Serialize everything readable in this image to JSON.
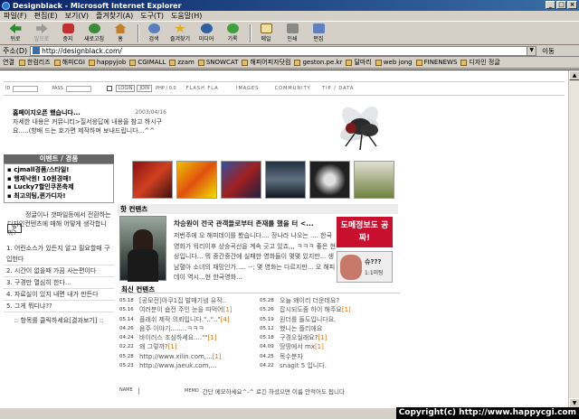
{
  "window": {
    "tab_title": "Designblack",
    "app_title": "Microsoft Internet Explorer"
  },
  "menu": [
    "파일(F)",
    "편집(E)",
    "보기(V)",
    "즐겨찾기(A)",
    "도구(T)",
    "도움말(H)"
  ],
  "toolbar": {
    "back": "뒤로",
    "forward": "앞으로",
    "stop": "중지",
    "refresh": "새로고침",
    "home": "홈",
    "search": "검색",
    "favorites": "즐겨찾기",
    "media": "미디어",
    "history": "기록",
    "mail": "메일",
    "print": "인쇄",
    "edit": "편집"
  },
  "address": {
    "label": "주소(D)",
    "url": "http://designblack.com/",
    "go": "이동"
  },
  "links": {
    "label": "연결",
    "items": [
      "한컴리즈",
      "해피CGI",
      "happyjob",
      "CGIMALL",
      "zzam",
      "SNOWCAT",
      "해피어피자닷컴",
      "geston.pe.kr",
      "달마리",
      "web jong",
      "FINENEWS",
      "디자인 정글"
    ]
  },
  "site": {
    "login": {
      "pass_label": "PASS",
      "login_btn": "LOGIN",
      "join_btn": "JOIN",
      "version": "PHP / 0.0"
    },
    "nav": [
      "FLASH FLA",
      "IMAGES",
      "COMMUNITY",
      "TIP / DATA"
    ],
    "notice": {
      "title": "홈페이지오픈 했습니다...",
      "date": "2003/04/16",
      "body": "자세한 내용은 커뮤니티>질서응답에 내용을 참고 하시구요.....(향배 드는 호가면 제작하며 보내드립니다...^^"
    },
    "event": {
      "header": "이벤트 / 경품",
      "items": [
        "cjmall경품/스타일!",
        "행재낙원! 10원경매!",
        "Lucky7할인쿠폰축제",
        "최고의팅,퀸가디자!"
      ]
    },
    "promo": {
      "text": "정글이나 갯파일등에서 전환하는 디자인컨텐츠에 매해 어떻게 생각합니까?",
      "box": "P"
    },
    "poll": [
      "1. 어린소스가 있든지 알고 필요할때 구입한다",
      "2. 시간이 없을때 가끔 사는편이다",
      "3. 구경만 열심히 한다...",
      "4. 자료실이 있지 내면 내가 만든다",
      "5. 그게 뭐디냐??"
    ],
    "poll_result": ":: 항목를 클릭하세요[결과보기] ::",
    "hot": {
      "header": "핫 컨텐츠",
      "title": "차승원이 전국 관객들로부터 존재를 했을 터 <...",
      "body": "저번주에 오 해피데이를 봤습니다.... 장나라 나오는 .... 한국영화가 워리이후 상승곡선을 계속 긋고 있죠,,, ㅋㅋㅋ 좋은 현상입니다... 뭐 중간중간에 실패한 영화들이 몇몇 있지만... 생남혈아 소녀의 재밍인가..... --; 몇 영화는 다르지만... 오 해피데이 역시...현 한국영화..."
    },
    "ads": {
      "ad1": "도메정보도 공짜!",
      "ad2_title": "슈???",
      "ad2_sub": "1:1미팅"
    },
    "latest": {
      "header": "최신 컨텐츠",
      "rows": [
        {
          "date": "05.18",
          "text": "[공모전]아쿠1집 발매기념 유작..",
          "comments": ""
        },
        {
          "date": "05.28",
          "text": "오늘 왜이리 더운데요?",
          "comments": ""
        },
        {
          "date": "05.16",
          "text": "여러분이 숍전 주인 눈을 따먹어",
          "comments": "[1]"
        },
        {
          "date": "05.26",
          "text": "잡시되도좀 하이 해주요",
          "comments": "[1]"
        },
        {
          "date": "05.14",
          "text": "플래쉬 제작 의뢰입니다.\"..\"..\"",
          "comments": "[4]"
        },
        {
          "date": "05.19",
          "text": "원더를 들도입니다요.",
          "comments": ""
        },
        {
          "date": "04.26",
          "text": "음주 이야기........ㅋㅋㅋ",
          "comments": ""
        },
        {
          "date": "05.12",
          "text": "했니는 플리애요",
          "comments": ""
        },
        {
          "date": "04.24",
          "text": "바이러스 조심하세요....\"\"",
          "comments": "[1]"
        },
        {
          "date": "05.18",
          "text": "구경오실래요?",
          "comments": "[1]"
        },
        {
          "date": "02.22",
          "text": "왜 그렇까?",
          "comments": "[1]"
        },
        {
          "date": "04.09",
          "text": "땅땅에서 mx",
          "comments": "[1]"
        },
        {
          "date": "05.28",
          "text": "http://www.xilin.com,...",
          "comments": "[1]"
        },
        {
          "date": "04.25",
          "text": "목수분자",
          "comments": ""
        },
        {
          "date": "05.23",
          "text": "http://www.jaeuk.com,...",
          "comments": ""
        },
        {
          "date": "04.22",
          "text": "snagit 5 입니다.",
          "comments": ""
        }
      ]
    },
    "memo": {
      "name_label": "NAME",
      "memo_label": "MEMO",
      "hint": "간단 메모하세요^-^ 로긴 하셨으면 이름 안적어도 됩니다"
    }
  },
  "copyright": "Copyright(c) http://www.happycgi.com"
}
